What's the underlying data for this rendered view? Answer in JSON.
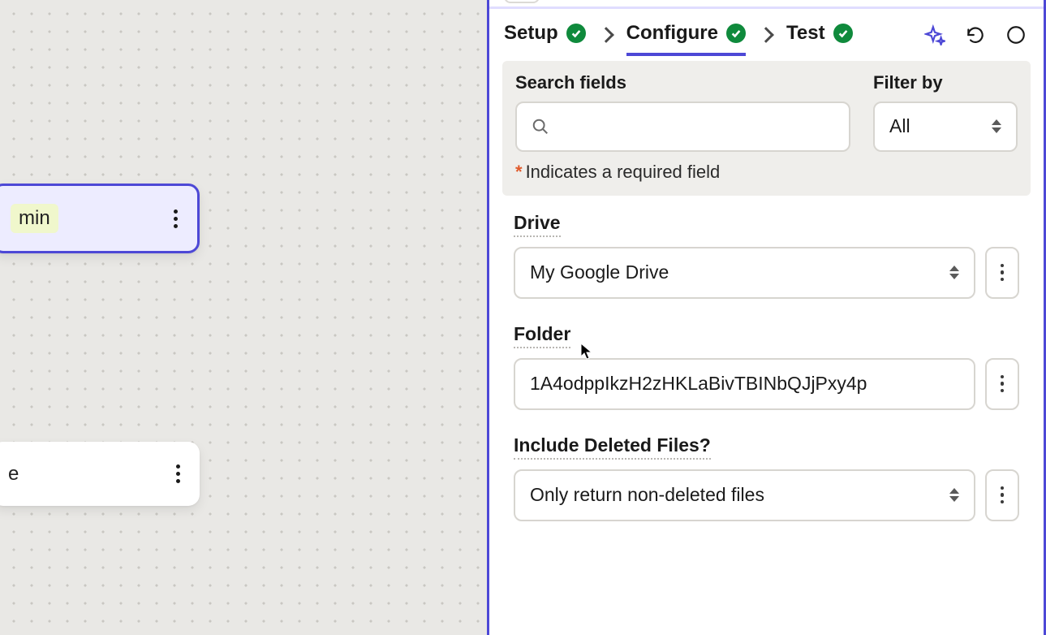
{
  "canvas": {
    "node_selected": {
      "pill_text": "min"
    },
    "node_plain": {
      "text": "e"
    }
  },
  "tabs": {
    "setup": "Setup",
    "configure": "Configure",
    "test": "Test"
  },
  "search": {
    "label": "Search fields",
    "placeholder": "",
    "filter_label": "Filter by",
    "filter_value": "All"
  },
  "required_note": "Indicates a required field",
  "fields": {
    "drive": {
      "label": "Drive",
      "value": "My Google Drive"
    },
    "folder": {
      "label": "Folder",
      "value": "1A4odppIkzH2zHKLaBivTBINbQJjPxy4p"
    },
    "include_deleted": {
      "label": "Include Deleted Files?",
      "value": "Only return non-deleted files"
    }
  }
}
